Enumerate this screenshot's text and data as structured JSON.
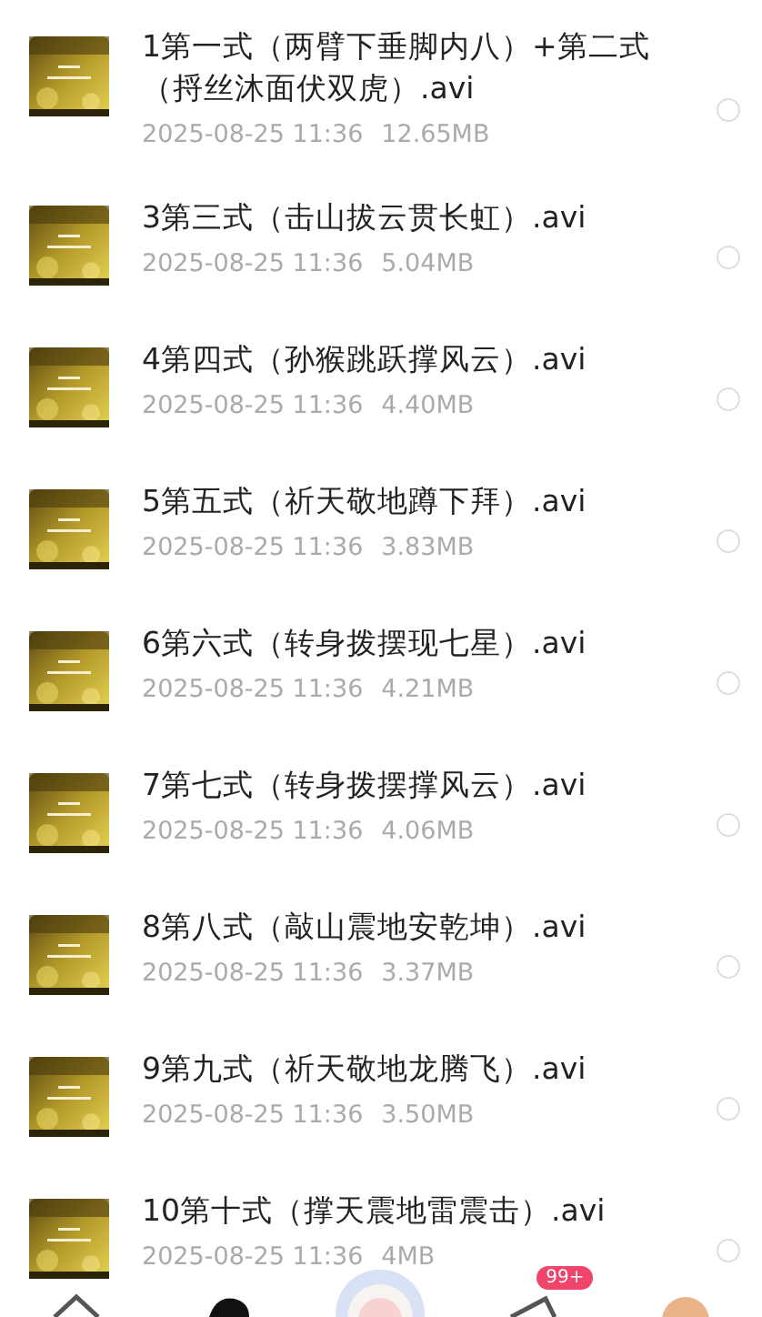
{
  "files": [
    {
      "title": "1第一式（两臂下垂脚内八）+第二式（捋丝沐面伏双虎）.avi",
      "datetime": "2025-08-25  11:36",
      "size": "12.65MB",
      "selected": false
    },
    {
      "title": "3第三式（击山拔云贯长虹）.avi",
      "datetime": "2025-08-25  11:36",
      "size": "5.04MB",
      "selected": false
    },
    {
      "title": "4第四式（孙猴跳跃撑风云）.avi",
      "datetime": "2025-08-25  11:36",
      "size": "4.40MB",
      "selected": false
    },
    {
      "title": "5第五式（祈天敬地蹲下拜）.avi",
      "datetime": "2025-08-25  11:36",
      "size": "3.83MB",
      "selected": false
    },
    {
      "title": "6第六式（转身拨摆现七星）.avi",
      "datetime": "2025-08-25  11:36",
      "size": "4.21MB",
      "selected": false
    },
    {
      "title": "7第七式（转身拨摆撑风云）.avi",
      "datetime": "2025-08-25  11:36",
      "size": "4.06MB",
      "selected": false
    },
    {
      "title": "8第八式（敲山震地安乾坤）.avi",
      "datetime": "2025-08-25  11:36",
      "size": "3.37MB",
      "selected": false
    },
    {
      "title": "9第九式（祈天敬地龙腾飞）.avi",
      "datetime": "2025-08-25  11:36",
      "size": "3.50MB",
      "selected": false
    },
    {
      "title": "10第十式（撑天震地雷震击）.avi",
      "datetime": "2025-08-25  11:36",
      "size": "4MB",
      "selected": false
    }
  ],
  "nav": [
    {
      "kind": "home"
    },
    {
      "kind": "shape"
    },
    {
      "kind": "mascot"
    },
    {
      "kind": "send",
      "badge": "99+"
    },
    {
      "kind": "avatar"
    }
  ]
}
